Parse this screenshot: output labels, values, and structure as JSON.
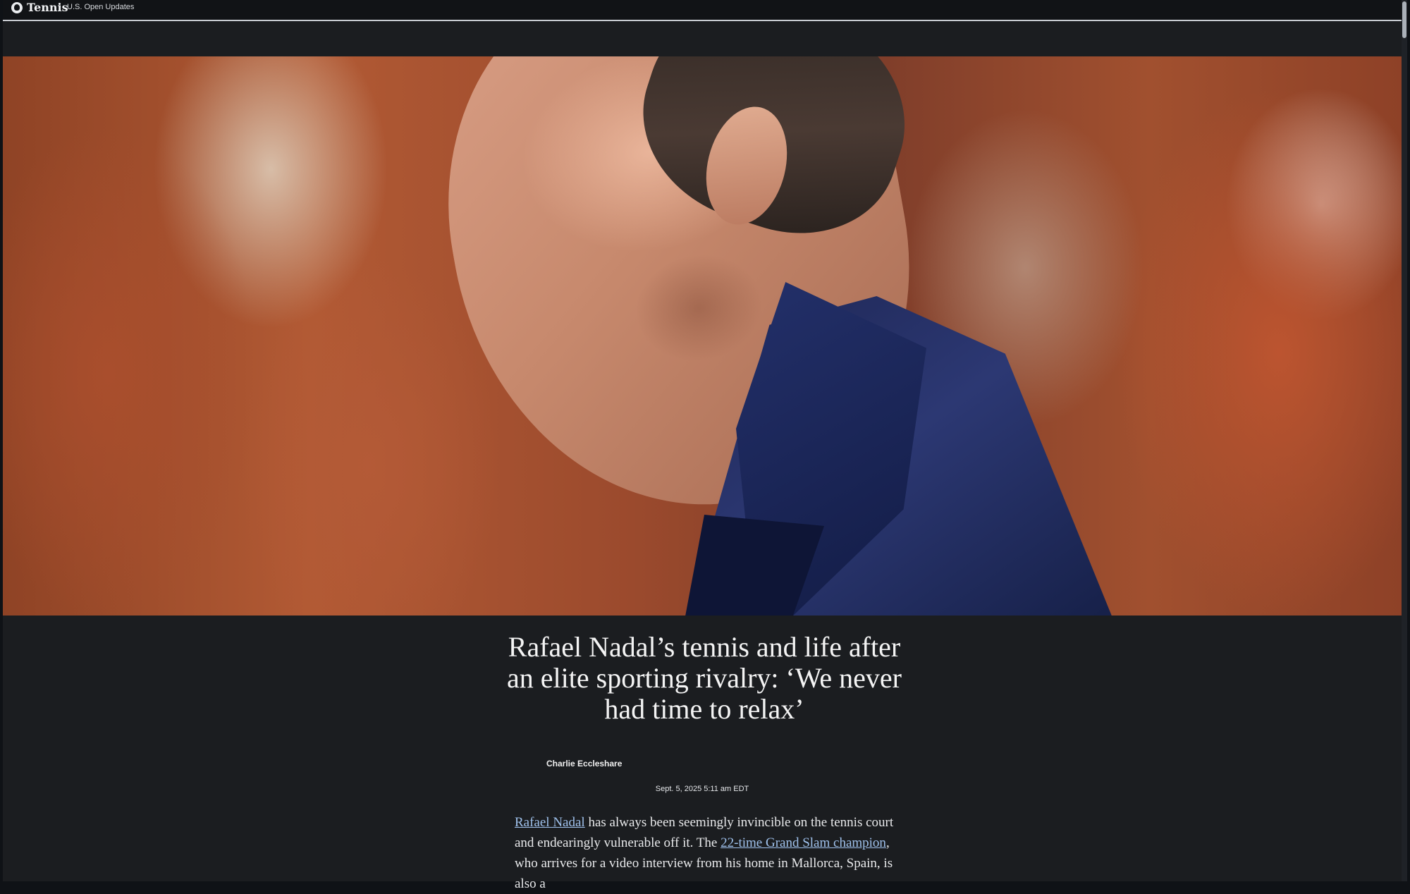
{
  "header": {
    "section_title": "Tennis",
    "nav_link": "U.S. Open Updates",
    "logo_icon": "the-athletic-logo-icon"
  },
  "hero": {
    "image_description_tag": "photo-icon"
  },
  "article": {
    "headline": "Rafael Nadal’s tennis and life after an elite sporting rivalry: ‘We never had time to relax’",
    "author": "Charlie Eccleshare",
    "date": "Sept. 5, 2025 5:11 am EDT",
    "body": {
      "link_1": "Rafael Nadal",
      "text_1": " has always been seemingly invincible on the tennis court and endearingly vulnerable off it. The ",
      "link_2": "22-time Grand Slam champion",
      "text_2": ", who arrives for a video interview from his home in Mallorca, Spain, is also a"
    }
  },
  "colors": {
    "background": "#1b1d20",
    "text": "#f4f4f4",
    "link": "#9fc1ec"
  }
}
